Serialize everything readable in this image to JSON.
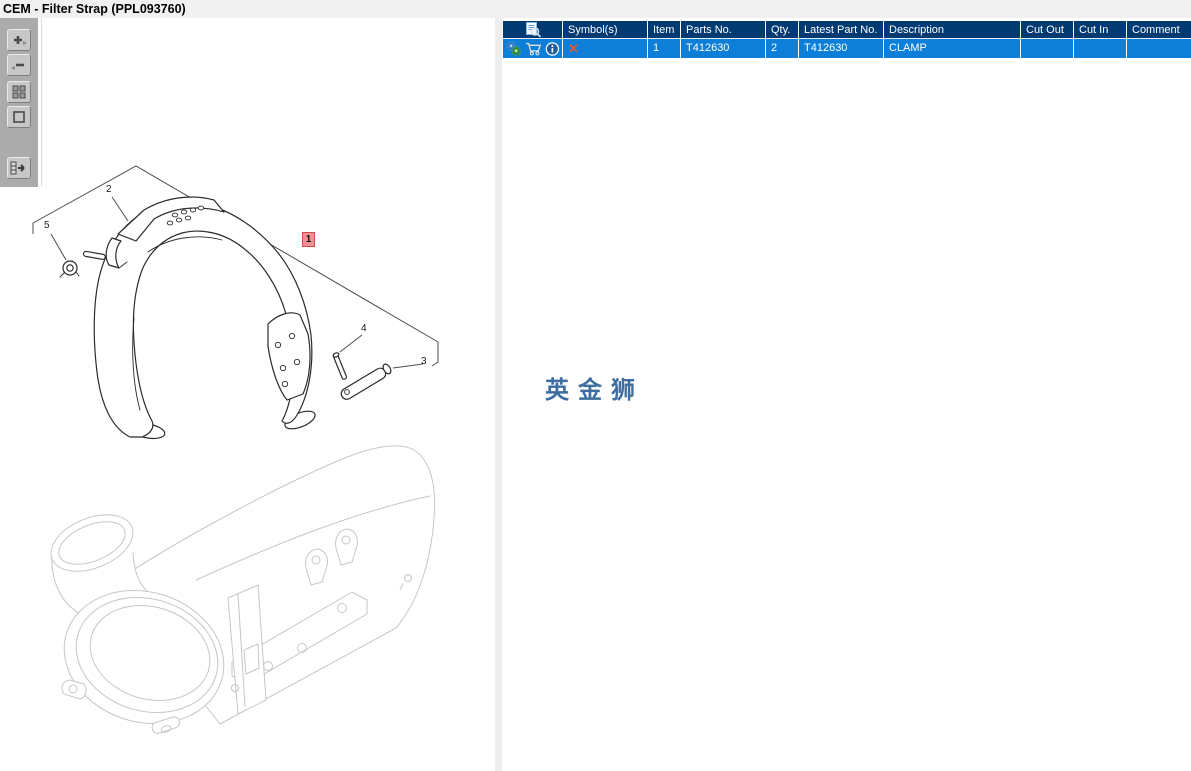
{
  "window": {
    "title": "CEM - Filter Strap (PPL093760)"
  },
  "toolbar": {
    "buttons": [
      {
        "id": "zoom-in",
        "glyph": "+"
      },
      {
        "id": "zoom-out",
        "glyph": "−"
      },
      {
        "id": "tile-windows",
        "glyph": ""
      },
      {
        "id": "single-window",
        "glyph": ""
      },
      {
        "id": "toggle-list-panel",
        "glyph": ""
      }
    ]
  },
  "diagram": {
    "callouts": [
      {
        "label": "2",
        "highlighted": false
      },
      {
        "label": "5",
        "highlighted": false
      },
      {
        "label": "1",
        "highlighted": true
      },
      {
        "label": "4",
        "highlighted": false
      },
      {
        "label": "3",
        "highlighted": false
      }
    ],
    "watermark": "英金狮"
  },
  "parts_table": {
    "columns": [
      "",
      "Symbol(s)",
      "Item",
      "Parts No.",
      "Qty.",
      "Latest Part No.",
      "Description",
      "Cut Out",
      "Cut In",
      "Comment"
    ],
    "rows": [
      {
        "symbol": "✕",
        "item": "1",
        "parts_no": "T412630",
        "qty": "2",
        "latest_part_no": "T412630",
        "description": "CLAMP",
        "cut_out": "",
        "cut_in": "",
        "comment": ""
      }
    ]
  },
  "colors": {
    "header_bg": "#003a72",
    "row_selected_bg": "#0d7fd8",
    "symbol_x": "#e8572e",
    "watermark": "#3e6da0",
    "callout_highlight_bg": "#f49093",
    "callout_highlight_border": "#ce4b4b"
  }
}
